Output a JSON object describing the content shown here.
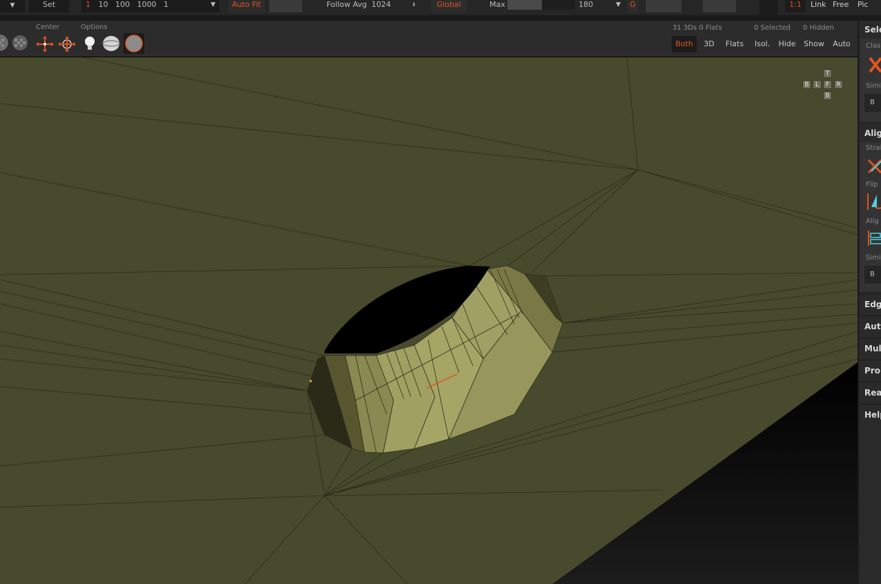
{
  "top_toolbar": {
    "set_label": "Set",
    "step_prefix": "1",
    "step_values": "10   100   1000   1",
    "auto_fit_label": "Auto Fit",
    "follow_avg_label": "Follow Avg",
    "follow_avg_value": "1024",
    "global_label": "Global",
    "max_label": "Max",
    "max_value": "180",
    "g_label": "G",
    "one_to_one_label": "1:1",
    "link_label": "Link",
    "free_label": "Free",
    "pic_label": "Pic"
  },
  "toolbar": {
    "center_label": "Center",
    "options_label": "Options",
    "counts": {
      "objects": "31 3Ds 0 Flats",
      "selected": "0 Selected",
      "hidden": "0 Hidden"
    },
    "view_buttons": [
      {
        "label": "Both",
        "active": true
      },
      {
        "label": "3D",
        "active": false
      },
      {
        "label": "Flats",
        "active": false
      },
      {
        "label": "Isol.",
        "active": false
      },
      {
        "label": "Hide",
        "active": false
      },
      {
        "label": "Show",
        "active": false
      },
      {
        "label": "Auto",
        "active": false
      }
    ]
  },
  "right_panel": {
    "select_title": "Sele",
    "class_label": "Clas",
    "simi_label": "Simi",
    "b_label": "B",
    "align_title": "Alig",
    "strai_label": "Strai",
    "flip_label": "Flip",
    "align_label": "Alig",
    "simi2_label": "Simi",
    "b2_label": "B",
    "sections": [
      "Edg",
      "Auto",
      "Mul",
      "Prop",
      "Real",
      "Help"
    ]
  },
  "nav_cube": {
    "top": "T",
    "back": "B",
    "left": "L",
    "front": "F",
    "right": "R",
    "bottom": "B"
  },
  "colors": {
    "accent": "#e0531f",
    "viewport_ground": "#484a2d",
    "cylinder_face": "#a3a264"
  }
}
